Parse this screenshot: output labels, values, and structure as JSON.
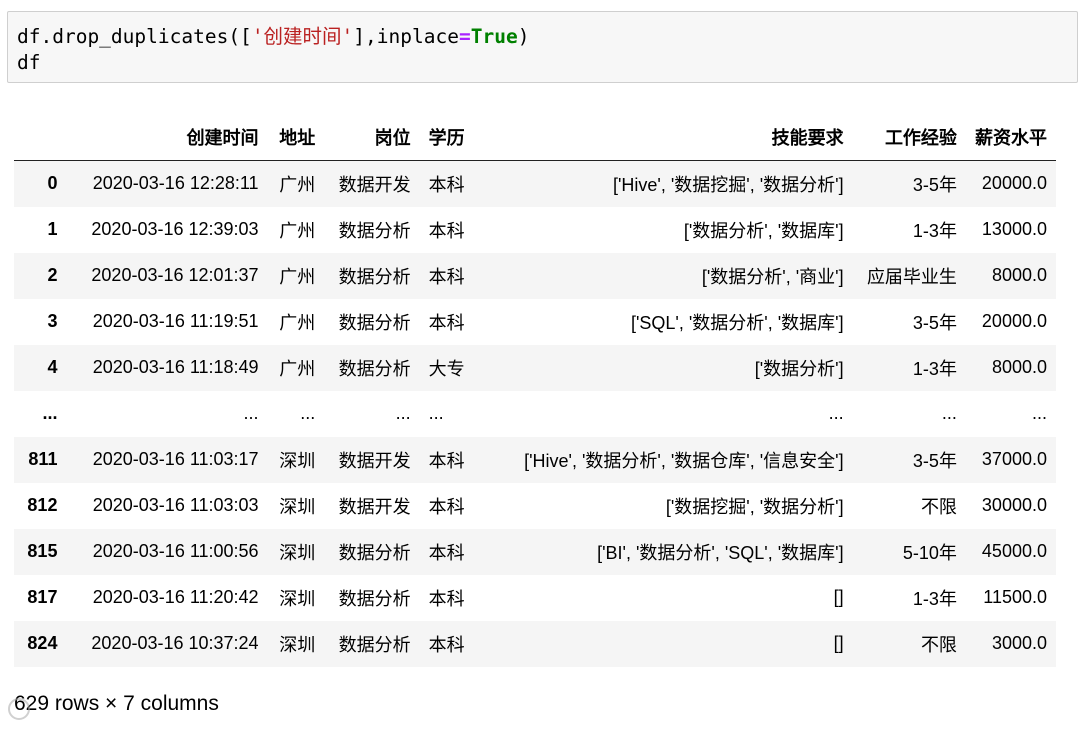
{
  "code": {
    "line1_pre": "df.drop_duplicates([",
    "line1_str": "'创建时间'",
    "line1_mid": "],inplace",
    "line1_op": "=",
    "line1_kw": "True",
    "line1_post": ")",
    "line2": "df"
  },
  "table": {
    "columns": [
      "创建时间",
      "地址",
      "岗位",
      "学历",
      "技能要求",
      "工作经验",
      "薪资水平"
    ],
    "rows": [
      {
        "index": "0",
        "cells": [
          "2020-03-16 12:28:11",
          "广州",
          "数据开发",
          "本科",
          "['Hive', '数据挖掘', '数据分析']",
          "3-5年",
          "20000.0"
        ]
      },
      {
        "index": "1",
        "cells": [
          "2020-03-16 12:39:03",
          "广州",
          "数据分析",
          "本科",
          "['数据分析', '数据库']",
          "1-3年",
          "13000.0"
        ]
      },
      {
        "index": "2",
        "cells": [
          "2020-03-16 12:01:37",
          "广州",
          "数据分析",
          "本科",
          "['数据分析', '商业']",
          "应届毕业生",
          "8000.0"
        ]
      },
      {
        "index": "3",
        "cells": [
          "2020-03-16 11:19:51",
          "广州",
          "数据分析",
          "本科",
          "['SQL', '数据分析', '数据库']",
          "3-5年",
          "20000.0"
        ]
      },
      {
        "index": "4",
        "cells": [
          "2020-03-16 11:18:49",
          "广州",
          "数据分析",
          "大专",
          "['数据分析']",
          "1-3年",
          "8000.0"
        ]
      },
      {
        "index": "...",
        "cells": [
          "...",
          "...",
          "...",
          "...",
          "...",
          "...",
          "..."
        ]
      },
      {
        "index": "811",
        "cells": [
          "2020-03-16 11:03:17",
          "深圳",
          "数据开发",
          "本科",
          "['Hive', '数据分析', '数据仓库', '信息安全']",
          "3-5年",
          "37000.0"
        ]
      },
      {
        "index": "812",
        "cells": [
          "2020-03-16 11:03:03",
          "深圳",
          "数据开发",
          "本科",
          "['数据挖掘', '数据分析']",
          "不限",
          "30000.0"
        ]
      },
      {
        "index": "815",
        "cells": [
          "2020-03-16 11:00:56",
          "深圳",
          "数据分析",
          "本科",
          "['BI', '数据分析', 'SQL', '数据库']",
          "5-10年",
          "45000.0"
        ]
      },
      {
        "index": "817",
        "cells": [
          "2020-03-16 11:20:42",
          "深圳",
          "数据分析",
          "本科",
          "[]",
          "1-3年",
          "11500.0"
        ]
      },
      {
        "index": "824",
        "cells": [
          "2020-03-16 10:37:24",
          "深圳",
          "数据分析",
          "本科",
          "[]",
          "不限",
          "3000.0"
        ]
      }
    ]
  },
  "shape_text": "629 rows × 7 columns",
  "watermark_icon": "watermark-logo-icon"
}
